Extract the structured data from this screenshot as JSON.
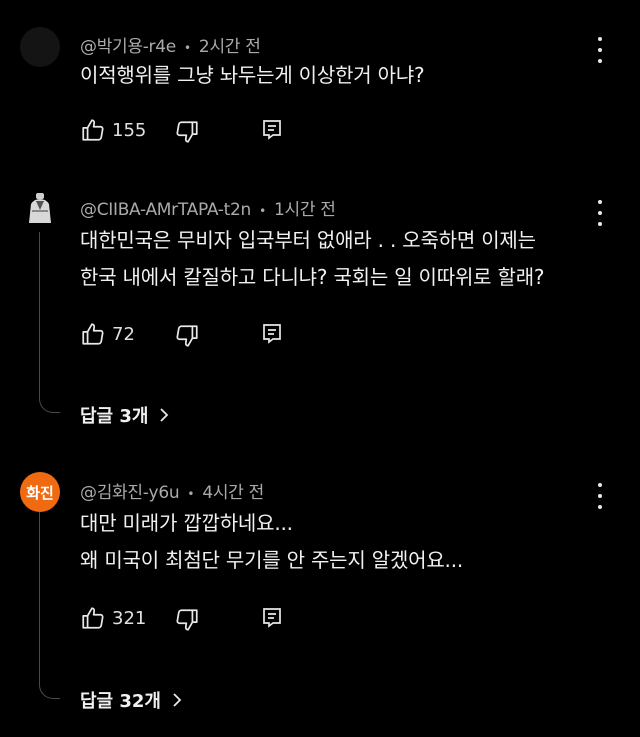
{
  "comments": [
    {
      "author": "@박기용-r4e",
      "time": "2시간 전",
      "lines": [
        "이적행위를 그냥 놔두는게 이상한거 아냐?"
      ],
      "likes": "155"
    },
    {
      "author": "@CIIBA-AMrTAPA-t2n",
      "time": "1시간 전",
      "lines": [
        "대한민국은 무비자 입국부터 없애라 . . 오죽하면 이제는",
        "한국 내에서 칼질하고 다니냐? 국회는 일 이따위로 할래?"
      ],
      "likes": "72",
      "replies": "답글 3개"
    },
    {
      "avatar_text": "화진",
      "author": "@김화진-y6u",
      "time": "4시간 전",
      "lines": [
        "대만 미래가 깝깝하네요...",
        "왜 미국이 최첨단 무기를 안 주는지 알겠어요..."
      ],
      "likes": "321",
      "replies": "답글 32개"
    }
  ],
  "separator": "•",
  "colors": {
    "background": "#000000",
    "text": "#f1f1f1",
    "meta": "#aaaaaa",
    "avatar_orange": "#f06a12"
  }
}
